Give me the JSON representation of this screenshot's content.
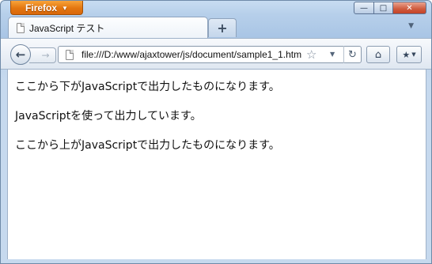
{
  "app": {
    "menu_label": "Firefox"
  },
  "window_controls": {
    "minimize": "—",
    "maximize": "□",
    "close": "✕"
  },
  "tab": {
    "title": "JavaScript テスト"
  },
  "toolbar": {
    "new_tab": "+",
    "tab_list": "▼",
    "url": "file:///D:/www/ajaxtower/js/document/sample1_1.htm",
    "back_icon": "←",
    "forward_icon": "→",
    "reload_icon": "↻",
    "home_icon": "⌂",
    "bookmarks_icon": "★"
  },
  "content": {
    "lines": [
      "ここから下がJavaScriptで出力したものになります。",
      "JavaScriptを使って出力しています。",
      "ここから上がJavaScriptで出力したものになります。"
    ]
  }
}
